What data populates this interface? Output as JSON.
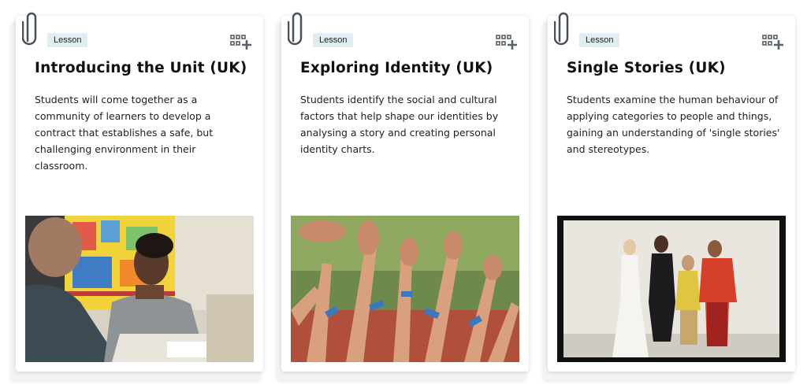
{
  "cards": [
    {
      "tag": "Lesson",
      "title": "Introducing the Unit (UK)",
      "description": "Students will come together as a community of learners to develop a contract that establishes a safe, but challenging environment in their classroom.",
      "image_subject": "classroom-students-photo"
    },
    {
      "tag": "Lesson",
      "title": "Exploring Identity (UK)",
      "description": "Students identify the social and cultural factors that help shape our identities by analysing a story and creating personal identity charts.",
      "image_subject": "raised-hands-crowd-photo"
    },
    {
      "tag": "Lesson",
      "title": "Single Stories (UK)",
      "description": "Students examine the human behaviour of applying categories to people and things, gaining an understanding of 'single stories' and stereotypes.",
      "image_subject": "group-portrait-photo"
    }
  ],
  "icons": [
    "paperclip-icon",
    "add-to-collection-icon"
  ],
  "colors": {
    "tag_bg": "#dfeef3",
    "title": "#111111",
    "icon": "#5a6068"
  }
}
